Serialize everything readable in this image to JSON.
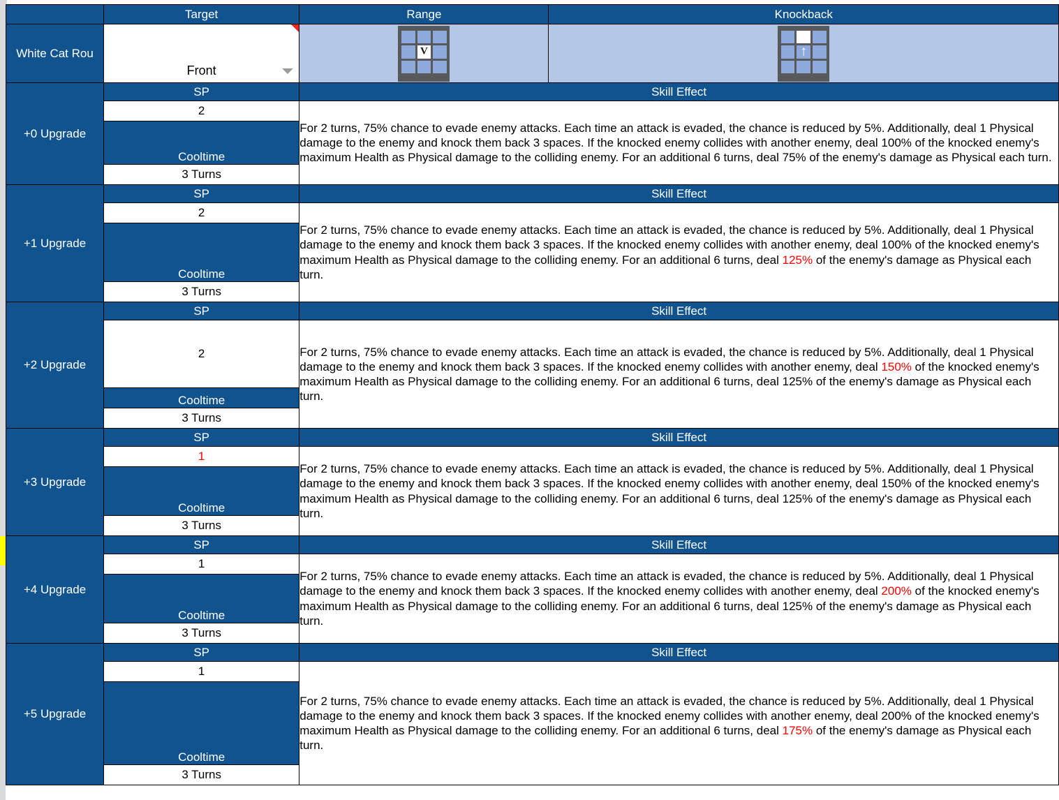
{
  "colors": {
    "header_blue": "#10538f",
    "light_blue": "#b4c7e7",
    "highlight_red": "#ff0000",
    "marker_yellow": "#ffff00",
    "grid_frame": "#58595b",
    "grid_cell": "#8ea9dc"
  },
  "columns": {
    "target": "Target",
    "range": "Range",
    "knockback": "Knockback",
    "sp": "SP",
    "cooltime": "Cooltime",
    "skill_effect": "Skill Effect"
  },
  "skill": {
    "name": "White Cat Rou",
    "target_value": "Front",
    "range_grid": {
      "cells": [
        [
          "off",
          "off",
          "off"
        ],
        [
          "off",
          "on",
          "off"
        ],
        [
          "off",
          "off",
          "off"
        ]
      ],
      "glyph": "V",
      "glyph_cell": [
        1,
        1
      ]
    },
    "knockback_grid": {
      "cells": [
        [
          "off",
          "on",
          "off"
        ],
        [
          "off",
          "off",
          "off"
        ],
        [
          "off",
          "off",
          "off"
        ]
      ],
      "glyph": "↑",
      "glyph_cell": [
        1,
        1
      ]
    }
  },
  "upgrades": [
    {
      "label": "+0 Upgrade",
      "sp": "2",
      "sp_red": false,
      "cooltime": "3 Turns",
      "marker": false,
      "effect_parts": [
        {
          "text": "For 2 turns, 75% chance to evade enemy attacks. Each time an attack is evaded, the chance is reduced by 5%. Additionally, deal 1 Physical damage to the enemy and knock them back 3 spaces. If the knocked enemy collides with another enemy, deal ",
          "red": false
        },
        {
          "text": "100%",
          "red": false
        },
        {
          "text": " of the knocked enemy's maximum Health as Physical damage to the colliding enemy. For an additional 6 turns, deal ",
          "red": false
        },
        {
          "text": "75%",
          "red": false
        },
        {
          "text": " of the enemy's damage as Physical each turn.",
          "red": false
        }
      ]
    },
    {
      "label": "+1 Upgrade",
      "sp": "2",
      "sp_red": false,
      "cooltime": "3 Turns",
      "marker": false,
      "effect_parts": [
        {
          "text": "For 2 turns, 75% chance to evade enemy attacks. Each time an attack is evaded, the chance is reduced by 5%. Additionally, deal 1 Physical damage to the enemy and knock them back 3 spaces. If the knocked enemy collides with another enemy, deal ",
          "red": false
        },
        {
          "text": "100%",
          "red": false
        },
        {
          "text": " of the knocked enemy's maximum Health as Physical damage to the colliding enemy. For an additional 6 turns, deal ",
          "red": false
        },
        {
          "text": "125%",
          "red": true
        },
        {
          "text": " of the enemy's damage as Physical each turn.",
          "red": false
        }
      ]
    },
    {
      "label": "+2 Upgrade",
      "sp": "2",
      "sp_red": false,
      "cooltime": "3 Turns",
      "marker": false,
      "effect_parts": [
        {
          "text": "For 2 turns, 75% chance to evade enemy attacks. Each time an attack is evaded, the chance is reduced by 5%. Additionally, deal 1 Physical damage to the enemy and knock them back 3 spaces. If the knocked enemy collides with another enemy, deal ",
          "red": false
        },
        {
          "text": "150%",
          "red": true
        },
        {
          "text": " of the knocked enemy's maximum Health as Physical damage to the colliding enemy. For an additional 6 turns, deal ",
          "red": false
        },
        {
          "text": "125%",
          "red": false
        },
        {
          "text": " of the enemy's damage as Physical each turn.",
          "red": false
        }
      ]
    },
    {
      "label": "+3 Upgrade",
      "sp": "1",
      "sp_red": true,
      "cooltime": "3 Turns",
      "marker": false,
      "effect_parts": [
        {
          "text": "For 2 turns, 75% chance to evade enemy attacks. Each time an attack is evaded, the chance is reduced by 5%. Additionally, deal 1 Physical damage to the enemy and knock them back 3 spaces. If the knocked enemy collides with another enemy, deal ",
          "red": false
        },
        {
          "text": "150%",
          "red": false
        },
        {
          "text": " of the knocked enemy's maximum Health as Physical damage to the colliding enemy. For an additional 6 turns, deal ",
          "red": false
        },
        {
          "text": "125%",
          "red": false
        },
        {
          "text": " of the enemy's damage as Physical each turn.",
          "red": false
        }
      ]
    },
    {
      "label": "+4 Upgrade",
      "sp": "1",
      "sp_red": false,
      "cooltime": "3 Turns",
      "marker": true,
      "effect_parts": [
        {
          "text": "For 2 turns, 75% chance to evade enemy attacks. Each time an attack is evaded, the chance is reduced by 5%. Additionally, deal 1 Physical damage to the enemy and knock them back 3 spaces. If the knocked enemy collides with another enemy, deal ",
          "red": false
        },
        {
          "text": "200%",
          "red": true
        },
        {
          "text": " of the knocked enemy's maximum Health as Physical damage to the colliding enemy. For an additional 6 turns, deal ",
          "red": false
        },
        {
          "text": "125%",
          "red": false
        },
        {
          "text": " of the enemy's damage as Physical each turn.",
          "red": false
        }
      ]
    },
    {
      "label": "+5 Upgrade",
      "sp": "1",
      "sp_red": false,
      "cooltime": "3 Turns",
      "marker": false,
      "effect_parts": [
        {
          "text": "For 2 turns, 75% chance to evade enemy attacks. Each time an attack is evaded, the chance is reduced by 5%. Additionally, deal 1 Physical damage to the enemy and knock them back 3 spaces. If the knocked enemy collides with another enemy, deal ",
          "red": false
        },
        {
          "text": "200%",
          "red": false
        },
        {
          "text": " of the knocked enemy's maximum Health as Physical damage to the colliding enemy. For an additional 6 turns, deal ",
          "red": false
        },
        {
          "text": "175%",
          "red": true
        },
        {
          "text": " of the enemy's damage as Physical each turn.",
          "red": false
        }
      ]
    }
  ]
}
